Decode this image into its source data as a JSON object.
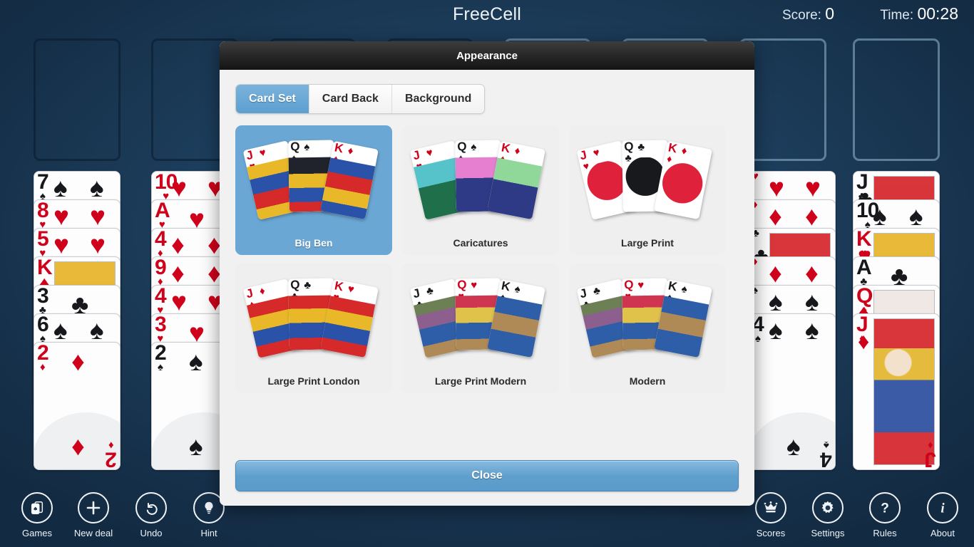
{
  "header": {
    "title": "FreeCell",
    "score_label": "Score:",
    "score_value": "0",
    "time_label": "Time:",
    "time_value": "00:28"
  },
  "dialog": {
    "title": "Appearance",
    "tabs": [
      {
        "label": "Card Set",
        "active": true
      },
      {
        "label": "Card Back",
        "active": false
      },
      {
        "label": "Background",
        "active": false
      }
    ],
    "card_sets": [
      {
        "label": "Big Ben",
        "selected": true
      },
      {
        "label": "Caricatures",
        "selected": false
      },
      {
        "label": "Large Print",
        "selected": false
      },
      {
        "label": "Large Print London",
        "selected": false
      },
      {
        "label": "Large Print Modern",
        "selected": false
      },
      {
        "label": "Modern",
        "selected": false
      }
    ],
    "close_label": "Close"
  },
  "toolbar": {
    "left": [
      {
        "label": "Games",
        "icon": "cards-icon"
      },
      {
        "label": "New deal",
        "icon": "plus-icon"
      },
      {
        "label": "Undo",
        "icon": "undo-arrow-icon"
      },
      {
        "label": "Hint",
        "icon": "lightbulb-icon"
      }
    ],
    "right": [
      {
        "label": "Scores",
        "icon": "crown-icon"
      },
      {
        "label": "Settings",
        "icon": "gear-icon"
      },
      {
        "label": "Rules",
        "icon": "question-mark-icon"
      },
      {
        "label": "About",
        "icon": "info-icon"
      }
    ]
  },
  "board": {
    "free_cells": [
      {
        "empty": true
      },
      {
        "empty": true
      },
      {
        "empty": true
      },
      {
        "empty": true
      }
    ],
    "foundations": [
      {
        "empty": true
      },
      {
        "empty": true
      },
      {
        "empty": true
      },
      {
        "empty": true
      }
    ],
    "columns": [
      {
        "cards": [
          {
            "rank": "7",
            "suit": "spades",
            "color": "black",
            "face": false
          },
          {
            "rank": "8",
            "suit": "hearts",
            "color": "red",
            "face": false
          },
          {
            "rank": "5",
            "suit": "hearts",
            "color": "red",
            "face": false
          },
          {
            "rank": "K",
            "suit": "diamonds",
            "color": "red",
            "face": true
          },
          {
            "rank": "3",
            "suit": "clubs",
            "color": "black",
            "face": false
          },
          {
            "rank": "6",
            "suit": "spades",
            "color": "black",
            "face": false
          },
          {
            "rank": "2",
            "suit": "diamonds",
            "color": "red",
            "face": false
          }
        ]
      },
      {
        "cards": [
          {
            "rank": "10",
            "suit": "hearts",
            "color": "red",
            "face": false
          },
          {
            "rank": "A",
            "suit": "hearts",
            "color": "red",
            "face": false
          },
          {
            "rank": "4",
            "suit": "diamonds",
            "color": "red",
            "face": false
          },
          {
            "rank": "9",
            "suit": "diamonds",
            "color": "red",
            "face": false
          },
          {
            "rank": "4",
            "suit": "hearts",
            "color": "red",
            "face": false
          },
          {
            "rank": "3",
            "suit": "hearts",
            "color": "red",
            "face": false
          },
          {
            "rank": "2",
            "suit": "spades",
            "color": "black",
            "face": false
          }
        ]
      },
      {
        "cards": [
          {
            "rank": "",
            "suit": "hearts",
            "color": "red",
            "face": false
          },
          {
            "rank": "",
            "suit": "diamonds",
            "color": "red",
            "face": false
          },
          {
            "rank": "",
            "suit": "clubs",
            "color": "black",
            "face": true
          },
          {
            "rank": "",
            "suit": "diamonds",
            "color": "red",
            "face": false
          },
          {
            "rank": "",
            "suit": "spades",
            "color": "black",
            "face": false
          },
          {
            "rank": "4",
            "suit": "spades",
            "color": "black",
            "face": false
          }
        ]
      },
      {
        "cards": [
          {
            "rank": "J",
            "suit": "clubs",
            "color": "black",
            "face": true
          },
          {
            "rank": "10",
            "suit": "spades",
            "color": "black",
            "face": false
          },
          {
            "rank": "K",
            "suit": "hearts",
            "color": "red",
            "face": true
          },
          {
            "rank": "A",
            "suit": "clubs",
            "color": "black",
            "face": false
          },
          {
            "rank": "Q",
            "suit": "diamonds",
            "color": "red",
            "face": true
          },
          {
            "rank": "J",
            "suit": "diamonds",
            "color": "red",
            "face": true
          }
        ]
      }
    ]
  },
  "colors": {
    "accent_blue": "#6ba7d4",
    "table_green": "#1d4161",
    "red_suit": "#d0021b",
    "black_suit": "#16181c"
  }
}
